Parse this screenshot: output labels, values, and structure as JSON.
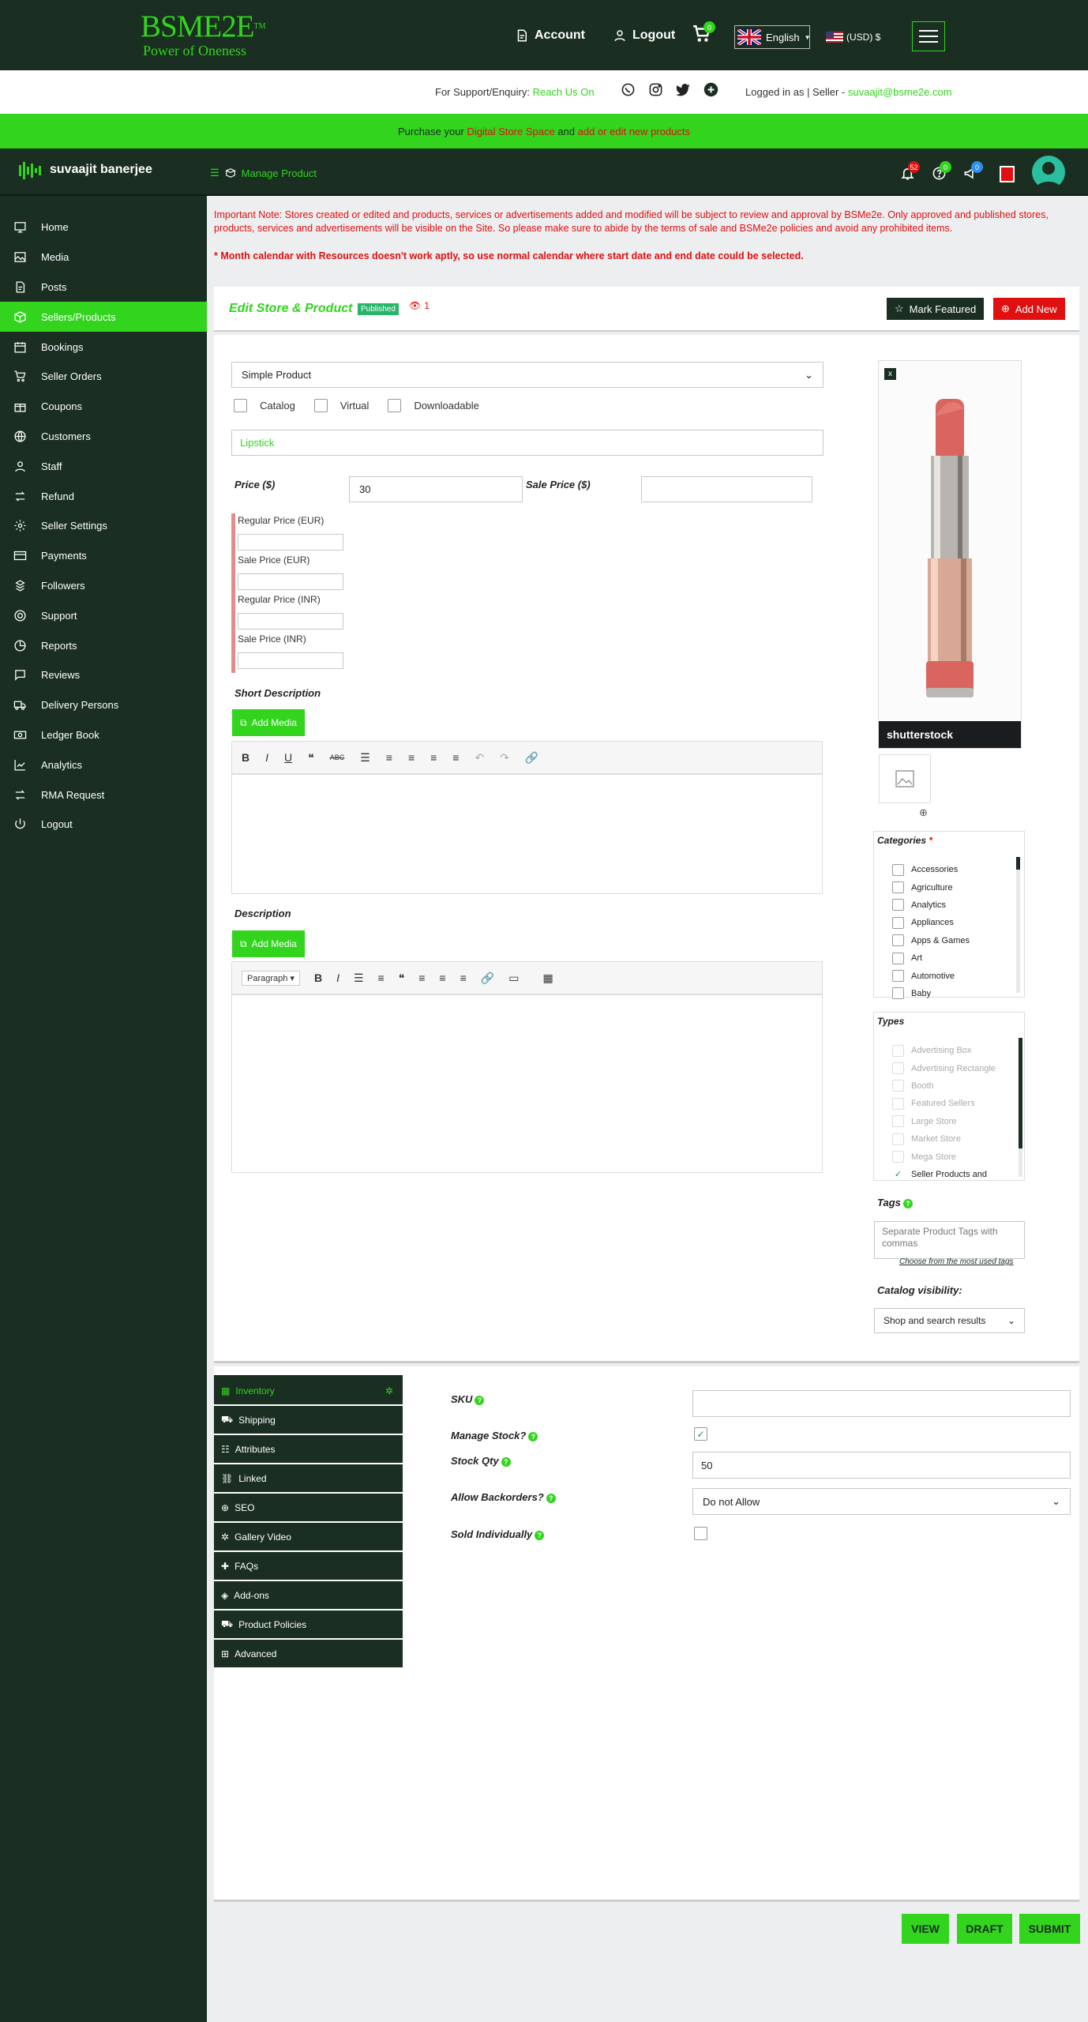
{
  "header": {
    "logo_main": "BSME2E",
    "logo_tm": "TM",
    "logo_tagline": "Power of Oneness",
    "account_label": "Account",
    "logout_label": "Logout",
    "cart_count": "0",
    "language": "English",
    "currency": "(USD) $"
  },
  "support": {
    "prefix": "For Support/Enquiry:",
    "reach": "Reach Us On",
    "logged_in": "Logged in as | Seller -",
    "email": "suvaajit@bsme2e.com"
  },
  "promo": {
    "text_a": "Purchase your",
    "link_a": "Digital Store Space",
    "text_b": "and",
    "link_b": "add or edit new products"
  },
  "subheader": {
    "username": "suvaajit banerjee",
    "breadcrumb": "Manage Product",
    "notif_count": "52",
    "help_count": "0",
    "msg_count": "0"
  },
  "sidebar": {
    "items": [
      {
        "label": "Home",
        "icon": "monitor-icon"
      },
      {
        "label": "Media",
        "icon": "image-icon"
      },
      {
        "label": "Posts",
        "icon": "document-icon"
      },
      {
        "label": "Sellers/Products",
        "icon": "box-icon"
      },
      {
        "label": "Bookings",
        "icon": "calendar-icon"
      },
      {
        "label": "Seller Orders",
        "icon": "cart-icon"
      },
      {
        "label": "Coupons",
        "icon": "gift-icon"
      },
      {
        "label": "Customers",
        "icon": "globe-icon"
      },
      {
        "label": "Staff",
        "icon": "user-icon"
      },
      {
        "label": "Refund",
        "icon": "refund-icon"
      },
      {
        "label": "Seller Settings",
        "icon": "settings-icon"
      },
      {
        "label": "Payments",
        "icon": "credit-card-icon"
      },
      {
        "label": "Followers",
        "icon": "followers-icon"
      },
      {
        "label": "Support",
        "icon": "support-icon"
      },
      {
        "label": "Reports",
        "icon": "reports-icon"
      },
      {
        "label": "Reviews",
        "icon": "chat-icon"
      },
      {
        "label": "Delivery Persons",
        "icon": "truck-icon"
      },
      {
        "label": "Ledger Book",
        "icon": "money-icon"
      },
      {
        "label": "Analytics",
        "icon": "chart-icon"
      },
      {
        "label": "RMA Request",
        "icon": "exchange-icon"
      },
      {
        "label": "Logout",
        "icon": "power-icon"
      }
    ]
  },
  "notices": {
    "important": "Important Note: Stores created or edited and products, services or advertisements added and modified will be subject to review and approval by BSMe2e. Only approved and published stores, products, services and advertisements will be visible on the Site. So please make sure to abide by the terms of sale and BSMe2e policies and avoid any prohibited items.",
    "calendar": "* Month calendar with Resources doesn't work aptly, so use normal calendar where start date and end date could be selected."
  },
  "edit_header": {
    "title": "Edit Store & Product",
    "status": "Published",
    "views": "1",
    "mark_featured": "Mark Featured",
    "add_new": "Add New"
  },
  "product": {
    "type": "Simple Product",
    "opt_catalog": "Catalog",
    "opt_virtual": "Virtual",
    "opt_downloadable": "Downloadable",
    "title": "Lipstick",
    "price_label": "Price ($)",
    "price": "30",
    "sale_price_label": "Sale Price ($)",
    "sale_price": "",
    "regular_eur": "Regular Price (EUR)",
    "sale_eur": "Sale Price (EUR)",
    "regular_inr": "Regular Price (INR)",
    "sale_inr": "Sale Price (INR)",
    "short_desc_label": "Short Description",
    "desc_label": "Description",
    "add_media": "Add Media",
    "paragraph": "Paragraph"
  },
  "image": {
    "remove": "x",
    "watermark": "shutterstock"
  },
  "categories": {
    "label": "Categories",
    "required": "*",
    "items": [
      "Accessories",
      "Agriculture",
      "Analytics",
      "Appliances",
      "Apps & Games",
      "Art",
      "Automotive",
      "Baby"
    ]
  },
  "types": {
    "label": "Types",
    "items": [
      "Advertising Box",
      "Advertising Rectangle",
      "Booth",
      "Featured Sellers",
      "Large Store",
      "Market Store",
      "Mega Store",
      "Seller Products and"
    ]
  },
  "tags": {
    "label": "Tags",
    "placeholder": "Separate Product Tags with commas",
    "choose": "Choose from the most used tags"
  },
  "catalog_visibility": {
    "label": "Catalog visibility:",
    "value": "Shop and search results"
  },
  "tabs": [
    "Inventory",
    "Shipping",
    "Attributes",
    "Linked",
    "SEO",
    "Gallery Video",
    "FAQs",
    "Add-ons",
    "Product Policies",
    "Advanced"
  ],
  "inventory": {
    "sku_label": "SKU",
    "sku": "",
    "manage_stock_label": "Manage Stock?",
    "stock_qty_label": "Stock Qty",
    "stock_qty": "50",
    "backorders_label": "Allow Backorders?",
    "backorders": "Do not Allow",
    "sold_individually_label": "Sold Individually"
  },
  "actions": {
    "view": "VIEW",
    "draft": "DRAFT",
    "submit": "SUBMIT"
  },
  "colors": {
    "brand_green": "#32d41e",
    "dark": "#1a2e22",
    "red": "#e01010"
  }
}
